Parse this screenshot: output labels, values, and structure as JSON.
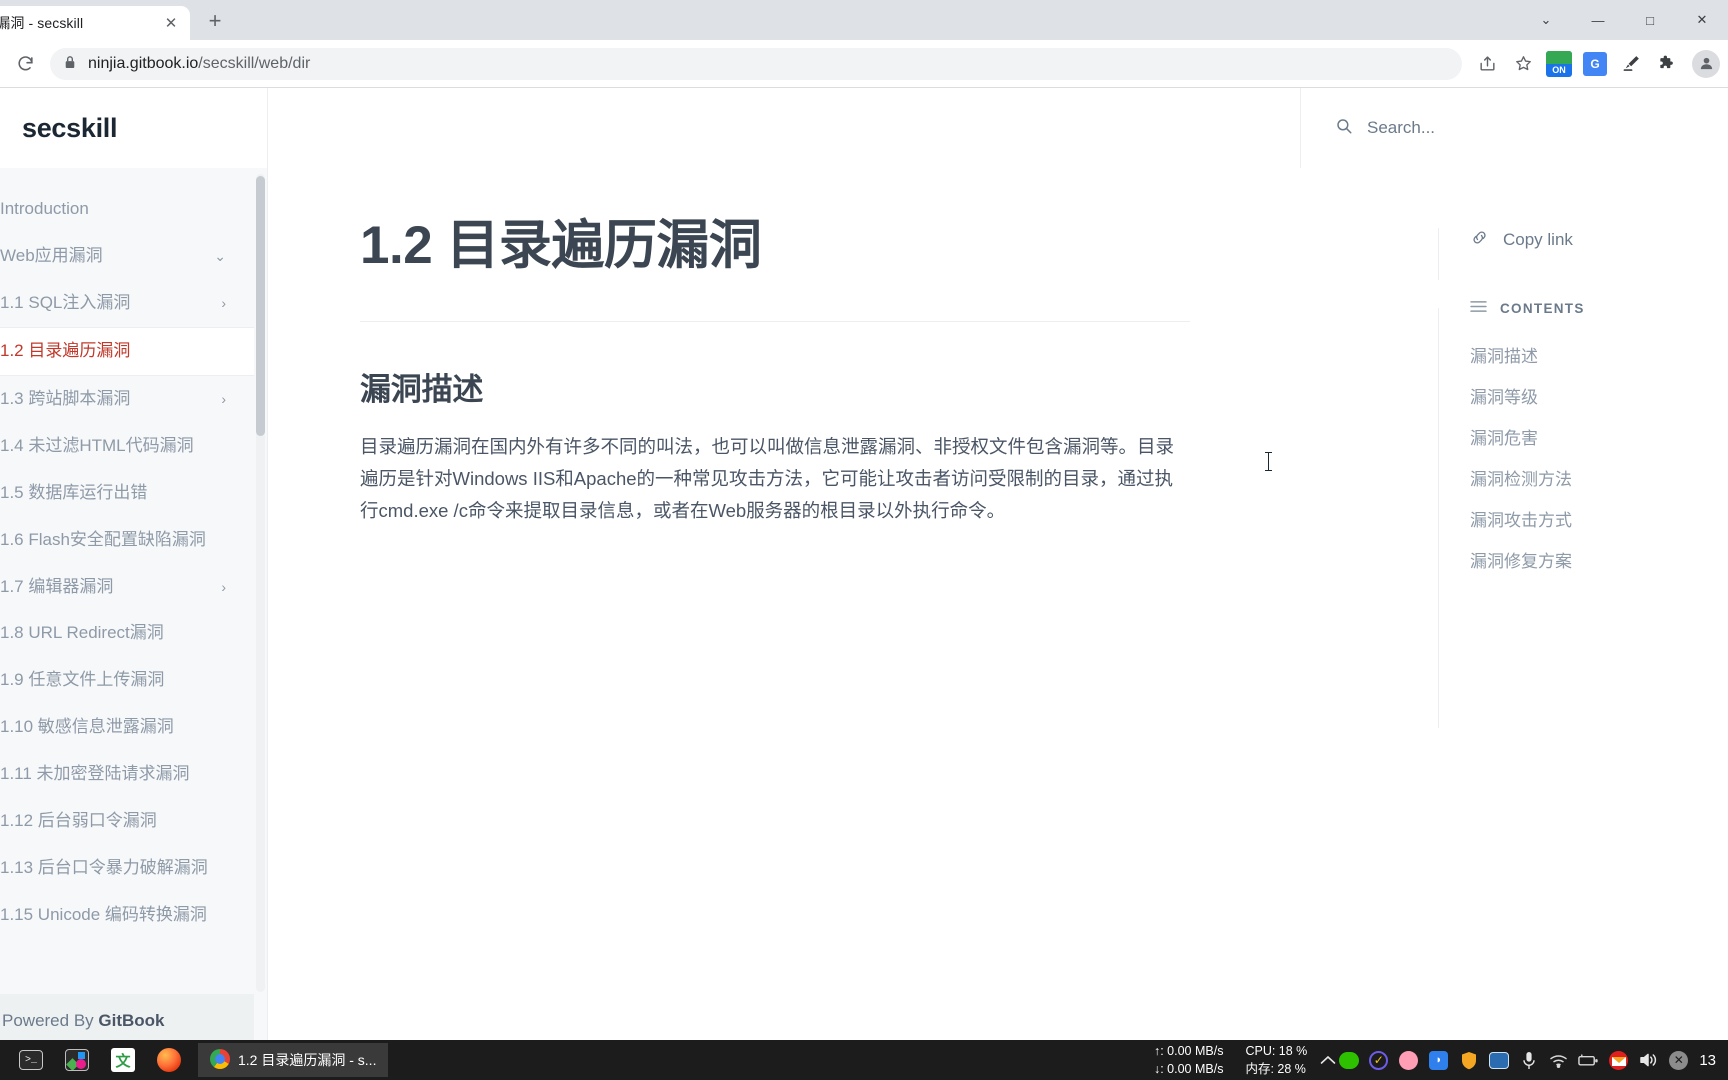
{
  "browser": {
    "tab": {
      "title": "录遍历漏洞 - secskill",
      "close_label": "✕"
    },
    "new_tab_label": "+",
    "window_controls": {
      "list": "⌄",
      "minimize": "—",
      "maximize": "□",
      "close": "✕"
    },
    "reload_label": "⟳",
    "url": {
      "lock": "🔒",
      "host": "ninjia.gitbook.io",
      "path": "/secskill/web/dir"
    },
    "toolbar_icons": [
      "share-icon",
      "bookmark-star-icon",
      "extension-on-icon",
      "google-translate-icon",
      "highlighter-icon",
      "puzzle-extensions-icon",
      "profile-avatar-icon"
    ],
    "extension_on_label": "ON",
    "translate_label": "G"
  },
  "site": {
    "brand": "secskill",
    "search_label": "Search...",
    "search_icon": "search-icon"
  },
  "sidebar": {
    "items": [
      {
        "label": "Introduction",
        "chevron": "",
        "active": false
      },
      {
        "label": "Web应用漏洞",
        "chevron": "⌄",
        "active": false
      },
      {
        "label": "1.1 SQL注入漏洞",
        "chevron": "›",
        "active": false
      },
      {
        "label": "1.2 目录遍历漏洞",
        "chevron": "",
        "active": true
      },
      {
        "label": "1.3 跨站脚本漏洞",
        "chevron": "›",
        "active": false
      },
      {
        "label": "1.4 未过滤HTML代码漏洞",
        "chevron": "",
        "active": false
      },
      {
        "label": "1.5 数据库运行出错",
        "chevron": "",
        "active": false
      },
      {
        "label": "1.6 Flash安全配置缺陷漏洞",
        "chevron": "",
        "active": false
      },
      {
        "label": "1.7 编辑器漏洞",
        "chevron": "›",
        "active": false
      },
      {
        "label": "1.8 URL Redirect漏洞",
        "chevron": "",
        "active": false
      },
      {
        "label": "1.9 任意文件上传漏洞",
        "chevron": "",
        "active": false
      },
      {
        "label": "1.10 敏感信息泄露漏洞",
        "chevron": "",
        "active": false
      },
      {
        "label": "1.11 未加密登陆请求漏洞",
        "chevron": "",
        "active": false
      },
      {
        "label": "1.12 后台弱口令漏洞",
        "chevron": "",
        "active": false
      },
      {
        "label": "1.13 后台口令暴力破解漏洞",
        "chevron": "",
        "active": false
      },
      {
        "label": "1.15 Unicode 编码转换漏洞",
        "chevron": "",
        "active": false
      }
    ],
    "footer": {
      "prefix": "Powered By ",
      "brand": "GitBook",
      "icon": "gitbook-logo-icon"
    }
  },
  "article": {
    "title": "1.2 目录遍历漏洞",
    "section_title": "漏洞描述",
    "paragraph": "目录遍历漏洞在国内外有许多不同的叫法，也可以叫做信息泄露漏洞、非授权文件包含漏洞等。目录遍历是针对Windows IIS和Apache的一种常见攻击方法，它可能让攻击者访问受限制的目录，通过执行cmd.exe /c命令来提取目录信息，或者在Web服务器的根目录以外执行命令。"
  },
  "right_rail": {
    "copy_link_label": "Copy link",
    "copy_link_icon": "link-icon",
    "contents_label": "CONTENTS",
    "contents_icon": "list-lines-icon",
    "toc": [
      "漏洞描述",
      "漏洞等级",
      "漏洞危害",
      "漏洞检测方法",
      "漏洞攻击方式",
      "漏洞修复方案"
    ]
  },
  "taskbar": {
    "apps": [
      {
        "name": "terminal-app-icon",
        "glyph": "▶_"
      },
      {
        "name": "photo-app-icon",
        "glyph": ""
      },
      {
        "name": "translate-app-icon",
        "glyph": "文"
      },
      {
        "name": "firefox-app-icon",
        "glyph": ""
      }
    ],
    "active_window": {
      "label": "1.2 目录遍历漏洞 - s...",
      "icon": "chrome-icon"
    },
    "stats": {
      "upload": "↑: 0.00 MB/s",
      "download": "↓: 0.00 MB/s",
      "cpu": "CPU: 18 %",
      "memory": "内存: 28 %"
    },
    "chevron_up": "^",
    "tray_icons": [
      "wechat-icon",
      "todo-check-icon",
      "flower-icon",
      "blue-app-icon",
      "shield-icon",
      "map-app-icon",
      "microphone-icon",
      "wifi-icon",
      "battery-icon",
      "mail-notification-icon",
      "volume-icon",
      "close-x-icon"
    ],
    "clock": "13"
  },
  "colors": {
    "accent_active": "#c0392b",
    "brand_dark": "#1b2733",
    "muted": "#8e9aa8",
    "sidebar_bg": "#f7f8f9",
    "chrome_tabstrip": "#dee1e6",
    "taskbar_bg": "#1c1c1c"
  }
}
